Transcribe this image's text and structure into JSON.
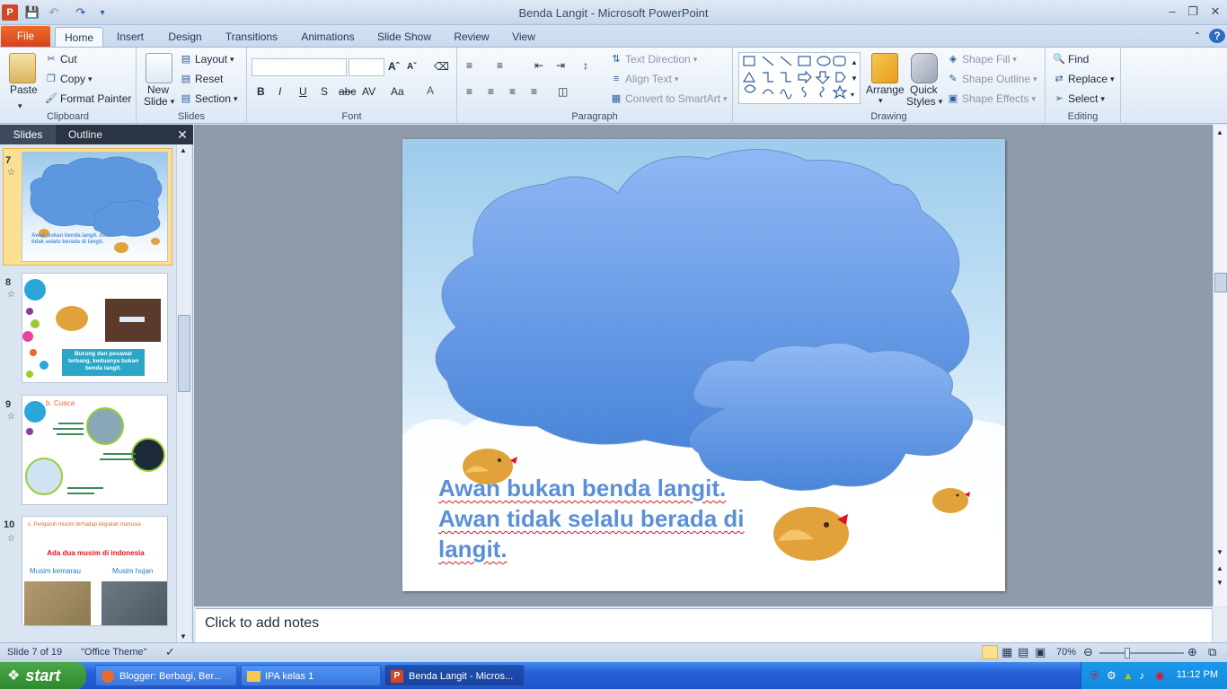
{
  "window": {
    "title": "Benda Langit  -  Microsoft PowerPoint"
  },
  "tabs": [
    "File",
    "Home",
    "Insert",
    "Design",
    "Transitions",
    "Animations",
    "Slide Show",
    "Review",
    "View"
  ],
  "ribbon": {
    "clipboard": {
      "paste": "Paste",
      "cut": "Cut",
      "copy": "Copy",
      "format_painter": "Format Painter",
      "label": "Clipboard"
    },
    "slides": {
      "new_slide_1": "New",
      "new_slide_2": "Slide",
      "layout": "Layout",
      "reset": "Reset",
      "section": "Section",
      "label": "Slides"
    },
    "font": {
      "label": "Font",
      "font_name": "",
      "font_size": ""
    },
    "paragraph": {
      "text_direction": "Text Direction",
      "align_text": "Align Text",
      "convert_smartart": "Convert to SmartArt",
      "label": "Paragraph"
    },
    "drawing": {
      "arrange": "Arrange",
      "quick_styles_1": "Quick",
      "quick_styles_2": "Styles",
      "shape_fill": "Shape Fill",
      "shape_outline": "Shape Outline",
      "shape_effects": "Shape Effects",
      "label": "Drawing"
    },
    "editing": {
      "find": "Find",
      "replace": "Replace",
      "select": "Select",
      "label": "Editing"
    }
  },
  "panel": {
    "tab_slides": "Slides",
    "tab_outline": "Outline",
    "thumbnails": [
      {
        "number": "7",
        "text": "Awan bukan benda langit. Awan tidak selalu berada di langit."
      },
      {
        "number": "8",
        "text": "Burung dan pesawat terbang, keduanya bukan benda langit."
      },
      {
        "number": "9",
        "title": "b. Cuaca"
      },
      {
        "number": "10",
        "title": "c. Pengaruh musim terhadap kegiatan manusia",
        "heading": "Ada dua musim di indonesia",
        "left_caption": "Musim kemarau",
        "right_caption": "Musim hujan"
      }
    ]
  },
  "slide": {
    "line1": "Awan bukan benda langit.",
    "line2": "Awan tidak selalu berada di",
    "line3": "langit."
  },
  "notes": {
    "placeholder": "Click to add notes"
  },
  "status": {
    "slide_info": "Slide 7 of 19",
    "theme": "\"Office Theme\"",
    "zoom": "70%"
  },
  "taskbar": {
    "start": "start",
    "items": [
      "Blogger: Berbagi, Ber...",
      "IPA kelas 1",
      "Benda Langit - Micros..."
    ],
    "clock": "11:12 PM"
  },
  "colors": {
    "slide_text": "#5b8fd6",
    "cloud": "#5d97e0",
    "file_tab": "#e2521f",
    "taskbar": "#2560d8"
  }
}
